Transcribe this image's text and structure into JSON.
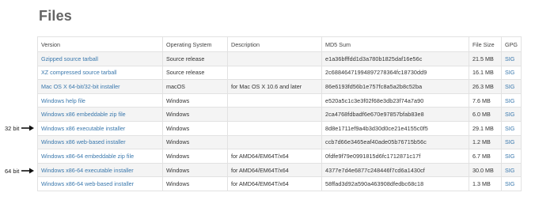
{
  "page": {
    "title": "Files"
  },
  "table": {
    "headers": {
      "version": "Version",
      "os": "Operating System",
      "description": "Description",
      "md5": "MD5 Sum",
      "size": "File Size",
      "gpg": "GPG"
    },
    "rows": [
      {
        "version": "Gzipped source tarball",
        "os": "Source release",
        "description": "",
        "md5": "e1a36bfffdd1d3a780b1825daf16e56c",
        "size": "21.5 MB",
        "gpg": "SIG"
      },
      {
        "version": "XZ compressed source tarball",
        "os": "Source release",
        "description": "",
        "md5": "2c68846471994897278364fc18730dd9",
        "size": "16.1 MB",
        "gpg": "SIG"
      },
      {
        "version": "Mac OS X 64-bit/32-bit installer",
        "os": "macOS",
        "description": "for Mac OS X 10.6 and later",
        "md5": "86e6193fd56b1e757fc8a5a2b8c52ba",
        "size": "26.3 MB",
        "gpg": "SIG"
      },
      {
        "version": "Windows help file",
        "os": "Windows",
        "description": "",
        "md5": "e520a5c1c3e3f02f68e3db23f74a7a90",
        "size": "7.6 MB",
        "gpg": "SIG"
      },
      {
        "version": "Windows x86 embeddable zip file",
        "os": "Windows",
        "description": "",
        "md5": "2ca4768fdbadf6e670e97857bfab83e8",
        "size": "6.0 MB",
        "gpg": "SIG"
      },
      {
        "version": "Windows x86 executable installer",
        "os": "Windows",
        "description": "",
        "md5": "8d8e1711ef9a4b3d30d0ce21e4155c0f5",
        "size": "29.1 MB",
        "gpg": "SIG"
      },
      {
        "version": "Windows x86 web-based installer",
        "os": "Windows",
        "description": "",
        "md5": "ccb7d66e3465eaf40ade05b76715b56c",
        "size": "1.2 MB",
        "gpg": "SIG"
      },
      {
        "version": "Windows x86-64 embeddable zip file",
        "os": "Windows",
        "description": "for AMD64/EM64T/x64",
        "md5": "0fdfe9f79e0991815d6fc1712871c17f",
        "size": "6.7 MB",
        "gpg": "SIG"
      },
      {
        "version": "Windows x86-64 executable installer",
        "os": "Windows",
        "description": "for AMD64/EM64T/x64",
        "md5": "4377e7d4e6877c248446f7cd6a1430cf",
        "size": "30.0 MB",
        "gpg": "SIG"
      },
      {
        "version": "Windows x86-64 web-based installer",
        "os": "Windows",
        "description": "for AMD64/EM64T/x64",
        "md5": "58ffad3d92a590a463908dfedbc68c18",
        "size": "1.3 MB",
        "gpg": "SIG"
      }
    ]
  },
  "annotations": {
    "bit32": "32 bit",
    "bit64": "64 bit"
  },
  "colors": {
    "link": "#3a78ad",
    "heading": "#646464",
    "stripe": "#f4f4f4",
    "border": "#e2e2e2"
  }
}
